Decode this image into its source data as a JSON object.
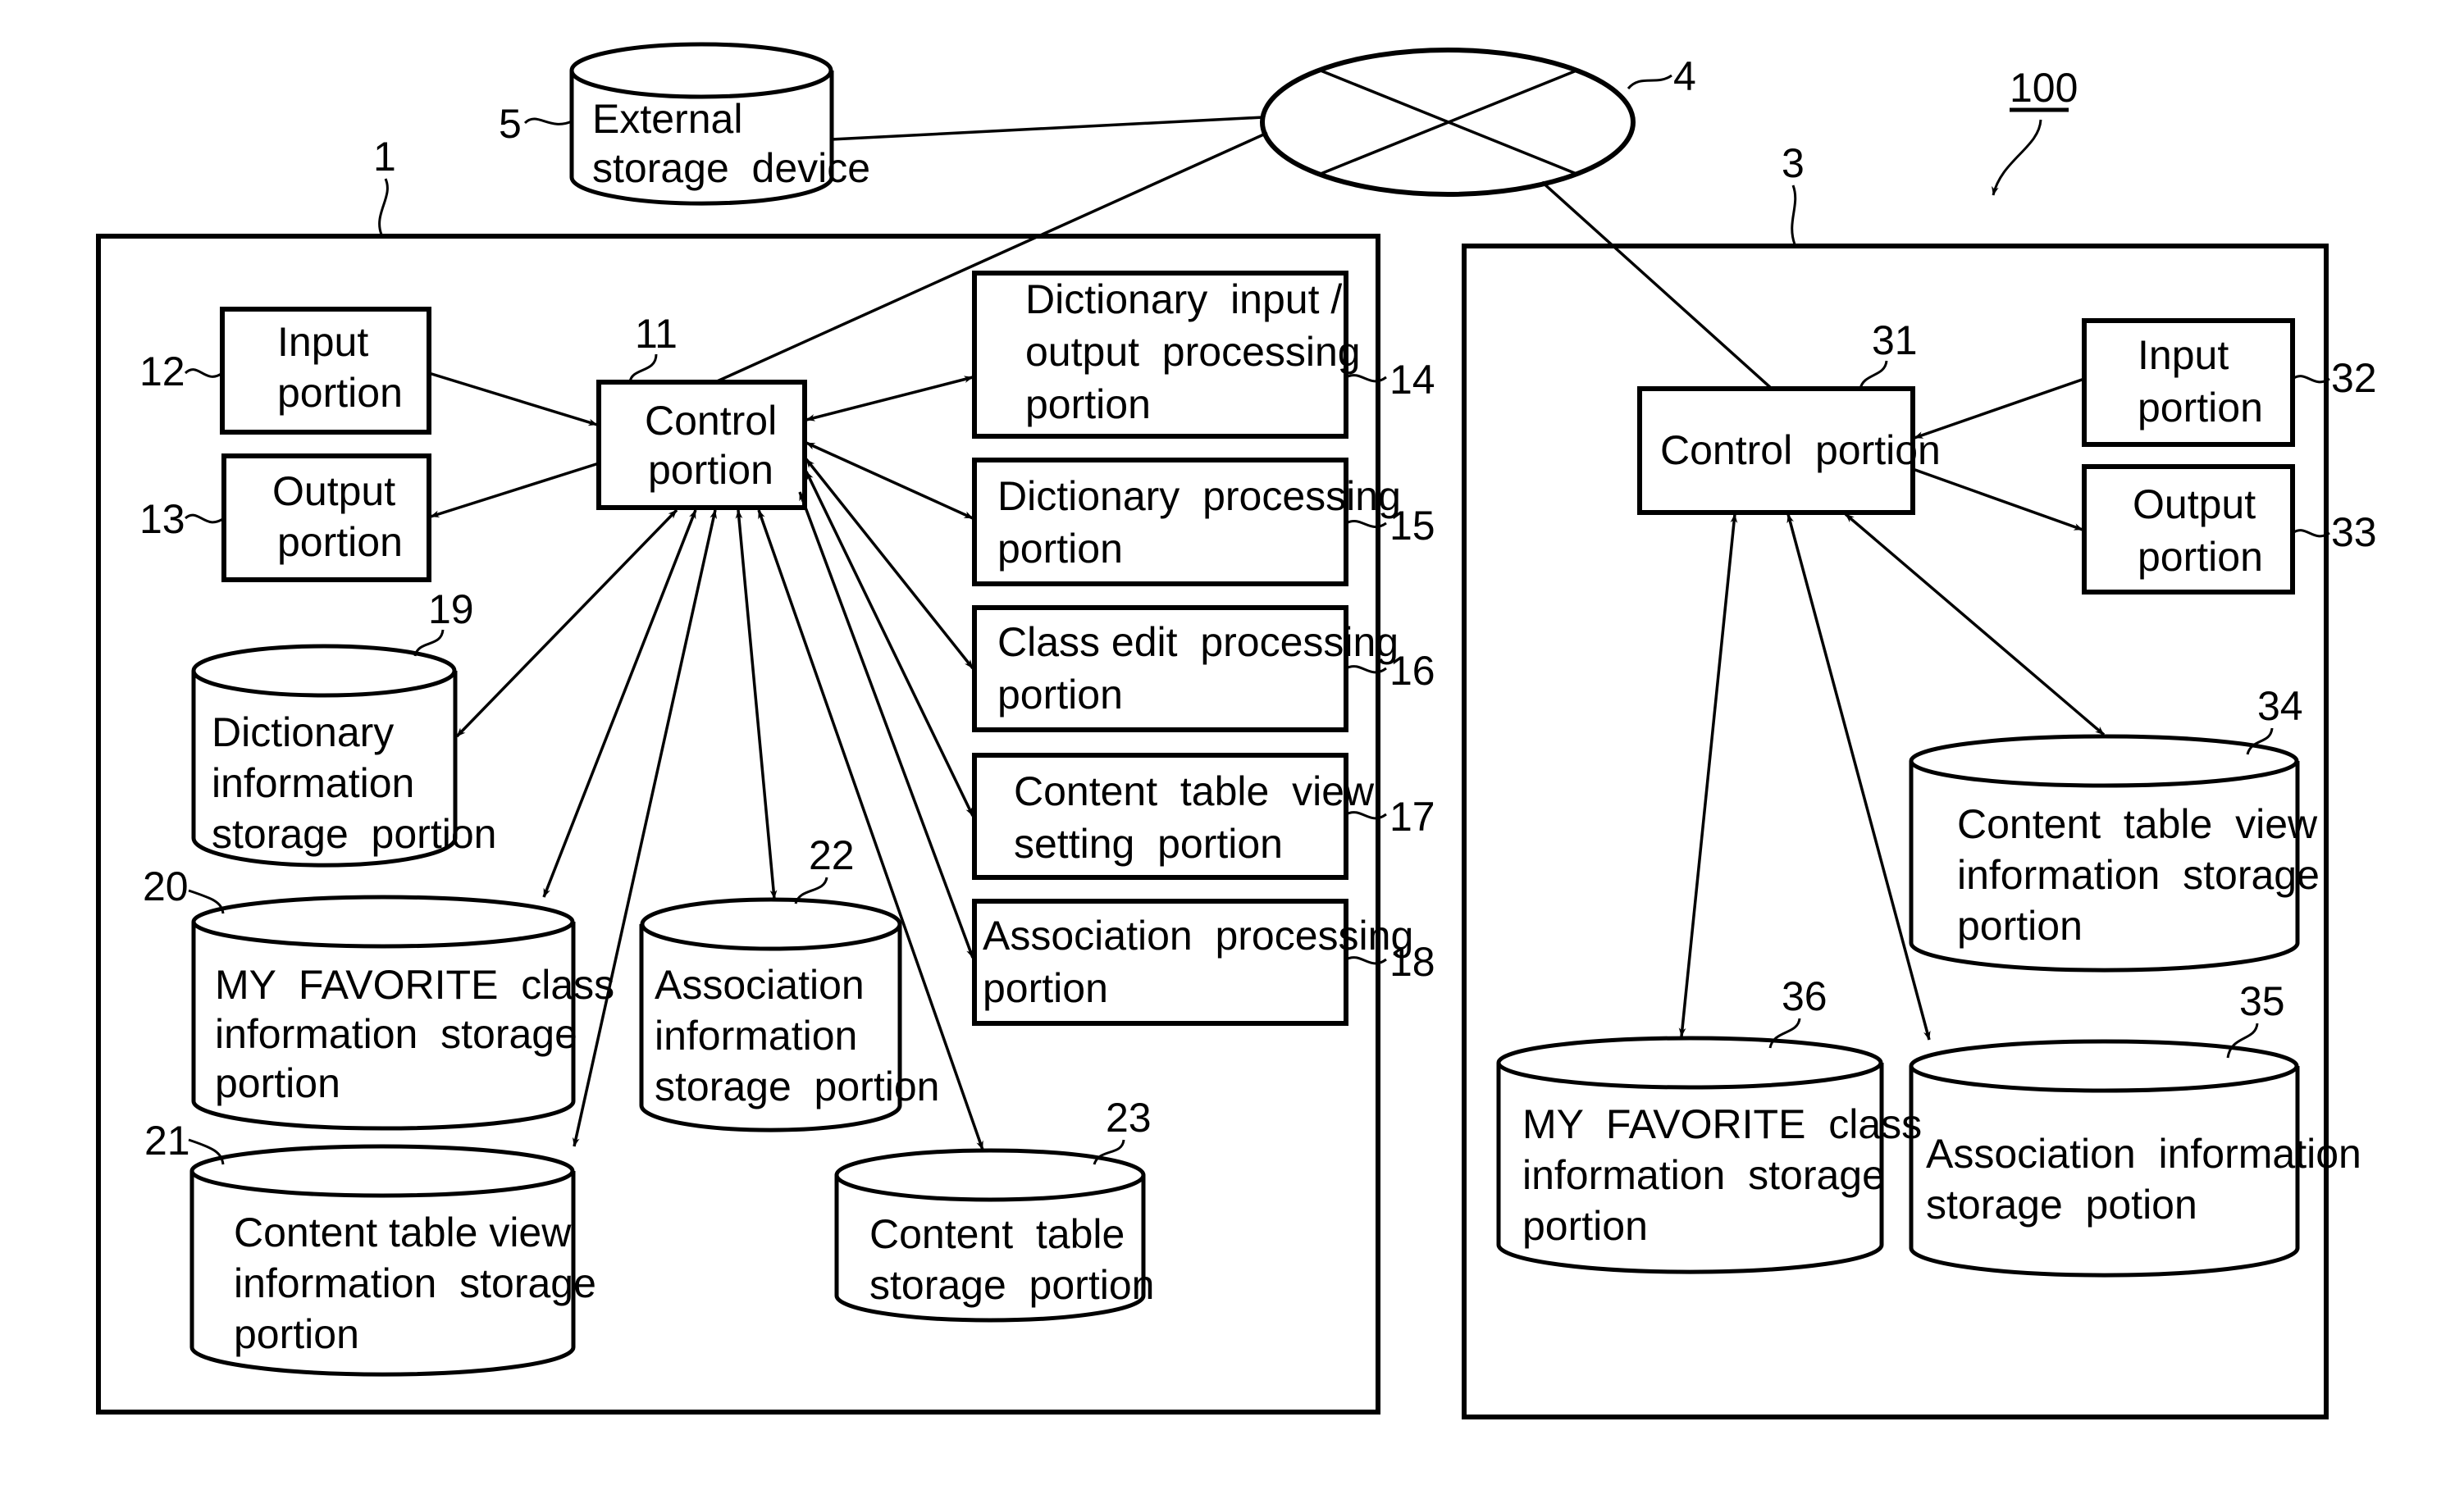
{
  "figure": {
    "system_ref": "100",
    "colors": {
      "ink": "#000000",
      "paper": "#ffffff"
    }
  },
  "network": {
    "ref": "4",
    "icon": "network-cross-icon"
  },
  "external_storage": {
    "ref": "5",
    "lines": [
      "External",
      "storage  device"
    ]
  },
  "apparatus_1": {
    "ref": "1",
    "control": {
      "ref": "11",
      "lines": [
        "Control",
        "portion"
      ]
    },
    "input": {
      "ref": "12",
      "lines": [
        "Input",
        "portion"
      ]
    },
    "output": {
      "ref": "13",
      "lines": [
        "Output",
        "portion"
      ]
    },
    "dict_io": {
      "ref": "14",
      "lines": [
        "Dictionary  input /",
        "output  processing",
        "portion"
      ]
    },
    "dict_proc": {
      "ref": "15",
      "lines": [
        "Dictionary  processing",
        "portion"
      ]
    },
    "class_edit": {
      "ref": "16",
      "lines": [
        "Class edit  processing",
        "portion"
      ]
    },
    "ctv_setting": {
      "ref": "17",
      "lines": [
        "Content  table  view",
        "setting  portion"
      ]
    },
    "assoc_proc": {
      "ref": "18",
      "lines": [
        "Association  processing",
        "portion"
      ]
    },
    "dict_info": {
      "ref": "19",
      "lines": [
        "Dictionary",
        "information",
        "storage  portion"
      ]
    },
    "myfav": {
      "ref": "20",
      "lines": [
        "MY  FAVORITE  class",
        "information  storage",
        "portion"
      ]
    },
    "ctv_info": {
      "ref": "21",
      "lines": [
        "Content table view",
        "information  storage",
        "portion"
      ]
    },
    "assoc_info": {
      "ref": "22",
      "lines": [
        "Association",
        "information",
        "storage  portion"
      ]
    },
    "content_table": {
      "ref": "23",
      "lines": [
        "Content  table",
        "storage  portion"
      ]
    }
  },
  "apparatus_3": {
    "ref": "3",
    "control": {
      "ref": "31",
      "lines": [
        "Control  portion"
      ]
    },
    "input": {
      "ref": "32",
      "lines": [
        "Input",
        "portion"
      ]
    },
    "output": {
      "ref": "33",
      "lines": [
        "Output",
        "portion"
      ]
    },
    "ctv_info": {
      "ref": "34",
      "lines": [
        "Content  table  view",
        "information  storage",
        "portion"
      ]
    },
    "assoc_info": {
      "ref": "35",
      "lines": [
        "Association  information",
        "storage  potion"
      ]
    },
    "myfav": {
      "ref": "36",
      "lines": [
        "MY  FAVORITE  class",
        "information  storage",
        "portion"
      ]
    }
  }
}
